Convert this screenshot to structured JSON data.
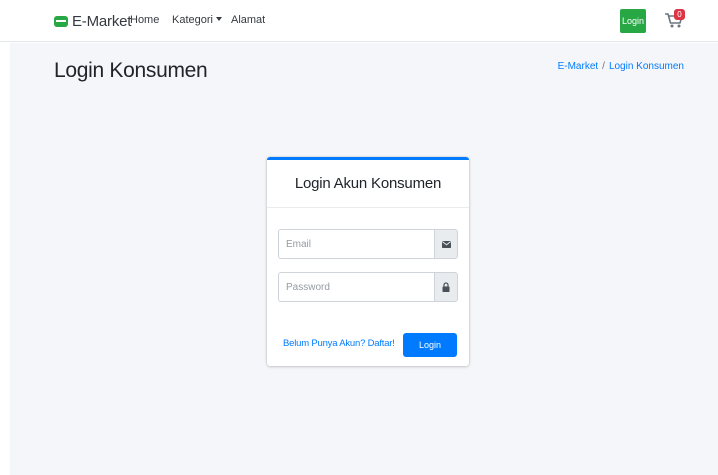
{
  "navbar": {
    "brand": "E-Market",
    "links": {
      "home": "Home",
      "kategori": "Kategori",
      "alamat": "Alamat"
    },
    "login_button": "Login",
    "cart_count": "0"
  },
  "page": {
    "title": "Login Konsumen",
    "breadcrumb": {
      "home": "E-Market",
      "separator": "/",
      "current": "Login Konsumen"
    }
  },
  "login_card": {
    "title": "Login Akun Konsumen",
    "email": {
      "value": "",
      "placeholder": "Email",
      "icon": "envelope-icon"
    },
    "password": {
      "value": "",
      "placeholder": "Password",
      "icon": "lock-icon"
    },
    "register_link": "Belum Punya Akun? Daftar!",
    "submit_label": "Login"
  },
  "colors": {
    "primary": "#007bff",
    "success": "#28a745",
    "danger": "#dc3545",
    "content_bg": "#f4f6f9"
  }
}
